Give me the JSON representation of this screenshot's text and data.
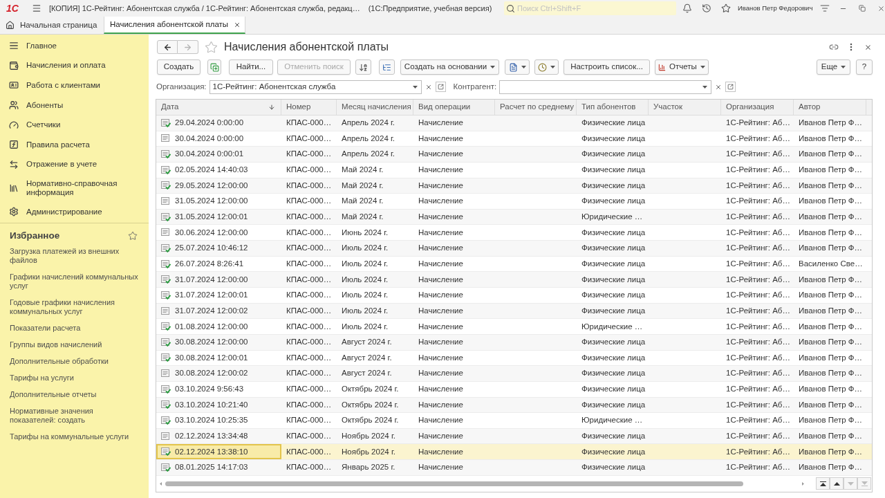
{
  "title_bar": {
    "logo": "1С",
    "title": "[КОПИЯ] 1С-Рейтинг: Абонентская служба / 1С-Рейтинг: Абонентская служба, редакц…",
    "subtitle": "(1С:Предприятие, учебная версия)",
    "search": {
      "placeholder": "Поиск Ctrl+Shift+F"
    },
    "user": "Иванов Петр Федорович"
  },
  "tabs": [
    {
      "kind": "home",
      "label": "Начальная страница",
      "selected": false
    },
    {
      "kind": "document",
      "label": "Начисления абонентской платы",
      "selected": true
    }
  ],
  "sidebar": {
    "sections": [
      {
        "label": "Главное"
      },
      {
        "label": "Начисления и оплата"
      },
      {
        "label": "Работа с клиентами"
      },
      {
        "label": "Абоненты"
      },
      {
        "label": "Счетчики"
      },
      {
        "label": "Правила расчета"
      },
      {
        "label": "Отражение в учете"
      },
      {
        "label": "Нормативно-справочная информация"
      },
      {
        "label": "Администрирование"
      }
    ],
    "favorites": {
      "title": "Избранное",
      "items": [
        "Загрузка платежей из внешних файлов",
        "Графики начислений коммунальных услуг",
        "Годовые графики начисления коммунальных услуг",
        "Показатели расчета",
        "Группы видов начислений",
        "Дополнительные обработки",
        "Тарифы на услуги",
        "Дополнительные отчеты",
        "Нормативные значения показателей: создать",
        "Тарифы на коммунальные услуги"
      ]
    }
  },
  "form": {
    "title": "Начисления абонентской платы",
    "navigation": {
      "back": {
        "disabled": false
      },
      "forward": {
        "disabled": true
      }
    },
    "toolbar": {
      "create": {
        "label": "Создать"
      },
      "find": {
        "label": "Найти..."
      },
      "cancel_search": {
        "label": "Отменить поиск",
        "disabled": true
      },
      "create_based_on": {
        "label": "Создать на основании"
      },
      "customize_list": {
        "label": "Настроить список..."
      },
      "reports": {
        "label": "Отчеты"
      },
      "more": {
        "label": "Еще"
      },
      "help": {
        "label": "?"
      }
    },
    "filters": [
      {
        "label": "Организация:",
        "value": "1С-Рейтинг: Абонентская служба"
      },
      {
        "label": "Контрагент:"
      }
    ],
    "table": {
      "columns": [
        {
          "label": "Дата",
          "sorted": true
        },
        {
          "label": "Номер",
          "sorted": false
        },
        {
          "label": "Месяц начисления",
          "sorted": false
        },
        {
          "label": "Вид операции",
          "sorted": false
        },
        {
          "label": "Расчет по среднему",
          "sorted": false
        },
        {
          "label": "Тип абонентов",
          "sorted": false
        },
        {
          "label": "Участок",
          "sorted": false
        },
        {
          "label": "Организация",
          "sorted": false
        },
        {
          "label": "Автор",
          "sorted": false
        }
      ],
      "rows": [
        {
          "selected": false,
          "posted": true,
          "date": "29.04.2024 0:00:00",
          "number": "КПАС-000…",
          "month": "Апрель 2024 г.",
          "operation": "Начисление",
          "subscriber_type": "Физические лица",
          "organization": "1С-Рейтинг: Аб…",
          "author": "Иванов Петр Ф…"
        },
        {
          "selected": false,
          "posted": false,
          "date": "30.04.2024 0:00:00",
          "number": "КПАС-000…",
          "month": "Апрель 2024 г.",
          "operation": "Начисление",
          "subscriber_type": "Физические лица",
          "organization": "1С-Рейтинг: Аб…",
          "author": "Иванов Петр Ф…"
        },
        {
          "selected": false,
          "posted": true,
          "date": "30.04.2024 0:00:01",
          "number": "КПАС-000…",
          "month": "Апрель 2024 г.",
          "operation": "Начисление",
          "subscriber_type": "Физические лица",
          "organization": "1С-Рейтинг: Аб…",
          "author": "Иванов Петр Ф…"
        },
        {
          "selected": false,
          "posted": true,
          "date": "02.05.2024 14:40:03",
          "number": "КПАС-000…",
          "month": "Май 2024 г.",
          "operation": "Начисление",
          "subscriber_type": "Физические лица",
          "organization": "1С-Рейтинг: Аб…",
          "author": "Иванов Петр Ф…"
        },
        {
          "selected": false,
          "posted": true,
          "date": "29.05.2024 12:00:00",
          "number": "КПАС-000…",
          "month": "Май 2024 г.",
          "operation": "Начисление",
          "subscriber_type": "Физические лица",
          "organization": "1С-Рейтинг: Аб…",
          "author": "Иванов Петр Ф…"
        },
        {
          "selected": false,
          "posted": false,
          "date": "31.05.2024 12:00:00",
          "number": "КПАС-000…",
          "month": "Май 2024 г.",
          "operation": "Начисление",
          "subscriber_type": "Физические лица",
          "organization": "1С-Рейтинг: Аб…",
          "author": "Иванов Петр Ф…"
        },
        {
          "selected": false,
          "posted": true,
          "date": "31.05.2024 12:00:01",
          "number": "КПАС-000…",
          "month": "Май 2024 г.",
          "operation": "Начисление",
          "subscriber_type": "Юридические …",
          "organization": "1С-Рейтинг: Аб…",
          "author": "Иванов Петр Ф…"
        },
        {
          "selected": false,
          "posted": false,
          "date": "30.06.2024 12:00:00",
          "number": "КПАС-000…",
          "month": "Июнь 2024 г.",
          "operation": "Начисление",
          "subscriber_type": "Физические лица",
          "organization": "1С-Рейтинг: Аб…",
          "author": "Иванов Петр Ф…"
        },
        {
          "selected": false,
          "posted": true,
          "date": "25.07.2024 10:46:12",
          "number": "КПАС-000…",
          "month": "Июль 2024 г.",
          "operation": "Начисление",
          "subscriber_type": "Физические лица",
          "organization": "1С-Рейтинг: Аб…",
          "author": "Иванов Петр Ф…"
        },
        {
          "selected": false,
          "posted": true,
          "date": "26.07.2024 8:26:41",
          "number": "КПАС-000…",
          "month": "Июль 2024 г.",
          "operation": "Начисление",
          "subscriber_type": "Физические лица",
          "organization": "1С-Рейтинг: Аб…",
          "author": "Василенко Све…"
        },
        {
          "selected": false,
          "posted": true,
          "date": "31.07.2024 12:00:00",
          "number": "КПАС-000…",
          "month": "Июль 2024 г.",
          "operation": "Начисление",
          "subscriber_type": "Физические лица",
          "organization": "1С-Рейтинг: Аб…",
          "author": "Иванов Петр Ф…"
        },
        {
          "selected": false,
          "posted": true,
          "date": "31.07.2024 12:00:01",
          "number": "КПАС-000…",
          "month": "Июль 2024 г.",
          "operation": "Начисление",
          "subscriber_type": "Физические лица",
          "organization": "1С-Рейтинг: Аб…",
          "author": "Иванов Петр Ф…"
        },
        {
          "selected": false,
          "posted": false,
          "date": "31.07.2024 12:00:02",
          "number": "КПАС-000…",
          "month": "Июль 2024 г.",
          "operation": "Начисление",
          "subscriber_type": "Физические лица",
          "organization": "1С-Рейтинг: Аб…",
          "author": "Иванов Петр Ф…"
        },
        {
          "selected": false,
          "posted": true,
          "date": "01.08.2024 12:00:00",
          "number": "КПАС-000…",
          "month": "Июль 2024 г.",
          "operation": "Начисление",
          "subscriber_type": "Юридические …",
          "organization": "1С-Рейтинг: Аб…",
          "author": "Иванов Петр Ф…"
        },
        {
          "selected": false,
          "posted": true,
          "date": "30.08.2024 12:00:00",
          "number": "КПАС-000…",
          "month": "Август 2024 г.",
          "operation": "Начисление",
          "subscriber_type": "Физические лица",
          "organization": "1С-Рейтинг: Аб…",
          "author": "Иванов Петр Ф…"
        },
        {
          "selected": false,
          "posted": true,
          "date": "30.08.2024 12:00:01",
          "number": "КПАС-000…",
          "month": "Август 2024 г.",
          "operation": "Начисление",
          "subscriber_type": "Физические лица",
          "organization": "1С-Рейтинг: Аб…",
          "author": "Иванов Петр Ф…"
        },
        {
          "selected": false,
          "posted": false,
          "date": "30.08.2024 12:00:02",
          "number": "КПАС-000…",
          "month": "Август 2024 г.",
          "operation": "Начисление",
          "subscriber_type": "Физические лица",
          "organization": "1С-Рейтинг: Аб…",
          "author": "Иванов Петр Ф…"
        },
        {
          "selected": false,
          "posted": true,
          "date": "03.10.2024 9:56:43",
          "number": "КПАС-000…",
          "month": "Октябрь 2024 г.",
          "operation": "Начисление",
          "subscriber_type": "Физические лица",
          "organization": "1С-Рейтинг: Аб…",
          "author": "Иванов Петр Ф…"
        },
        {
          "selected": false,
          "posted": true,
          "date": "03.10.2024 10:21:40",
          "number": "КПАС-000…",
          "month": "Октябрь 2024 г.",
          "operation": "Начисление",
          "subscriber_type": "Физические лица",
          "organization": "1С-Рейтинг: Аб…",
          "author": "Иванов Петр Ф…"
        },
        {
          "selected": false,
          "posted": true,
          "date": "03.10.2024 10:25:35",
          "number": "КПАС-000…",
          "month": "Октябрь 2024 г.",
          "operation": "Начисление",
          "subscriber_type": "Юридические …",
          "organization": "1С-Рейтинг: Аб…",
          "author": "Иванов Петр Ф…"
        },
        {
          "selected": false,
          "posted": false,
          "date": "02.12.2024 13:34:48",
          "number": "КПАС-000…",
          "month": "Ноябрь 2024 г.",
          "operation": "Начисление",
          "subscriber_type": "Физические лица",
          "organization": "1С-Рейтинг: Аб…",
          "author": "Иванов Петр Ф…"
        },
        {
          "selected": true,
          "posted": true,
          "date": "02.12.2024 13:38:10",
          "number": "КПАС-000…",
          "month": "Ноябрь 2024 г.",
          "operation": "Начисление",
          "subscriber_type": "Физические лица",
          "organization": "1С-Рейтинг: Аб…",
          "author": "Иванов Петр Ф…"
        },
        {
          "selected": false,
          "posted": true,
          "date": "08.01.2025 14:17:03",
          "number": "КПАС-000…",
          "month": "Январь 2025 г.",
          "operation": "Начисление",
          "subscriber_type": "Физические лица",
          "organization": "1С-Рейтинг: Аб…",
          "author": "Иванов Петр Ф…"
        }
      ],
      "list_navigation": [
        {
          "disabled": false
        },
        {
          "disabled": false
        },
        {
          "disabled": true
        },
        {
          "disabled": true
        }
      ]
    }
  }
}
